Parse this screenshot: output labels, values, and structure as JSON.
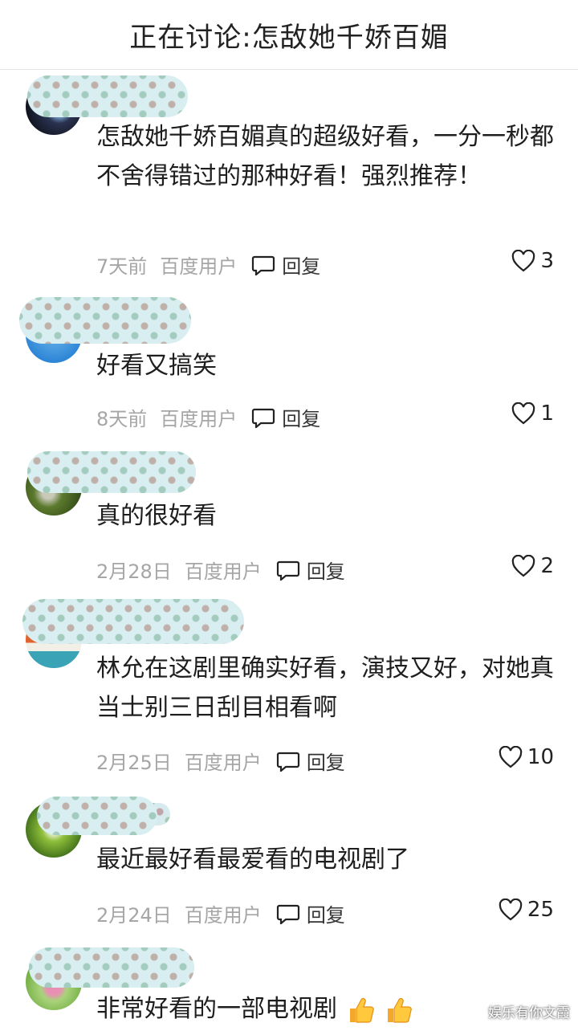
{
  "header": {
    "title": "正在讨论:怎敌她千娇百媚"
  },
  "comments": [
    {
      "text": "怎敌她千娇百媚真的超级好看，一分一秒都不舍得错过的那种好看！强烈推荐！",
      "time": "7天前",
      "source": "百度用户",
      "reply_label": "回复",
      "likes": "3"
    },
    {
      "text": "好看又搞笑",
      "time": "8天前",
      "source": "百度用户",
      "reply_label": "回复",
      "likes": "1"
    },
    {
      "text": "真的很好看",
      "time": "2月28日",
      "source": "百度用户",
      "reply_label": "回复",
      "likes": "2"
    },
    {
      "text": "林允在这剧里确实好看，演技又好，对她真当士别三日刮目相看啊",
      "time": "2月25日",
      "source": "百度用户",
      "reply_label": "回复",
      "likes": "10"
    },
    {
      "text": "最近最好看最爱看的电视剧了",
      "time": "2月24日",
      "source": "百度用户",
      "reply_label": "回复",
      "likes": "25"
    },
    {
      "text": "非常好看的一部电视剧",
      "emoji": "thumbs-up-icon"
    }
  ],
  "watermark": "娱乐有你文霞",
  "colors": {
    "meta": "#a6a6a6",
    "text": "#1e1e1e",
    "divider": "#e6e6e6"
  }
}
